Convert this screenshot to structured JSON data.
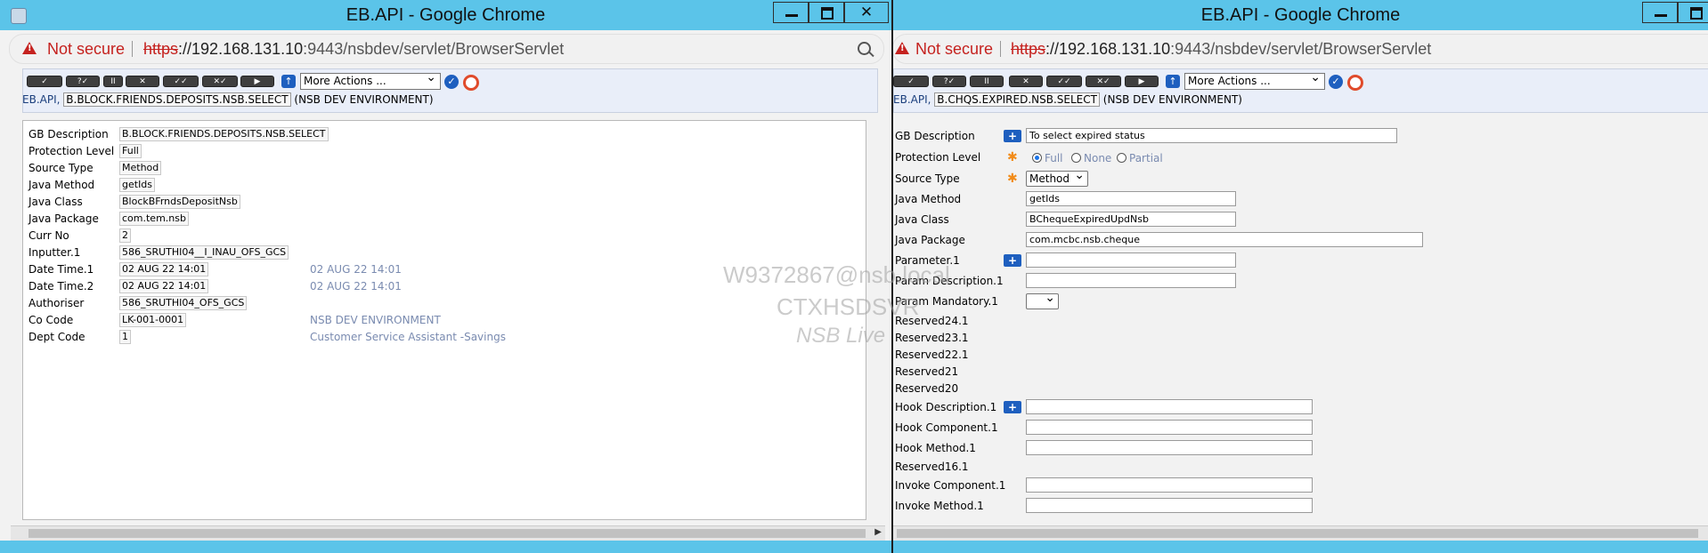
{
  "left_window": {
    "title": "EB.API - Google Chrome",
    "not_secure": "Not secure",
    "url_proto": "https",
    "url_host": "://192.168.131.10",
    "url_rest": ":9443/nsbdev/servlet/BrowserServlet",
    "toolbar_buttons": [
      "✓",
      "?✓",
      "II",
      "✕",
      "✓✓",
      "✕✓",
      "▶"
    ],
    "more_actions": "More Actions ...",
    "crumb_app": "EB.API,",
    "crumb_record": "B.BLOCK.FRIENDS.DEPOSITS.NSB.SELECT",
    "crumb_env": "(NSB DEV ENVIRONMENT)",
    "fields": [
      {
        "label": "GB Description",
        "value": "B.BLOCK.FRIENDS.DEPOSITS.NSB.SELECT",
        "enr": ""
      },
      {
        "label": "Protection Level",
        "value": "Full",
        "enr": ""
      },
      {
        "label": "Source Type",
        "value": "Method",
        "enr": ""
      },
      {
        "label": "Java Method",
        "value": "getIds",
        "enr": ""
      },
      {
        "label": "Java Class",
        "value": "BlockBFrndsDepositNsb",
        "enr": ""
      },
      {
        "label": "Java Package",
        "value": "com.tem.nsb",
        "enr": ""
      },
      {
        "label": "Curr No",
        "value": "2",
        "enr": ""
      },
      {
        "label": "Inputter.1",
        "value": "586_SRUTHI04__I_INAU_OFS_GCS",
        "enr": ""
      },
      {
        "label": "Date Time.1",
        "value": "02 AUG 22 14:01",
        "enr": "02 AUG 22 14:01"
      },
      {
        "label": "Date Time.2",
        "value": "02 AUG 22 14:01",
        "enr": "02 AUG 22 14:01"
      },
      {
        "label": "Authoriser",
        "value": "586_SRUTHI04_OFS_GCS",
        "enr": ""
      },
      {
        "label": "Co Code",
        "value": "LK-001-0001",
        "enr": "NSB DEV ENVIRONMENT"
      },
      {
        "label": "Dept Code",
        "value": "1",
        "enr": "Customer Service Assistant -Savings"
      }
    ]
  },
  "right_window": {
    "title": "EB.API - Google Chrome",
    "not_secure": "Not secure",
    "url_proto": "https",
    "url_host": "://192.168.131.10",
    "url_rest": ":9443/nsbdev/servlet/BrowserServlet",
    "more_actions": "More Actions ...",
    "crumb_app": "EB.API,",
    "crumb_record": "B.CHQS.EXPIRED.NSB.SELECT",
    "crumb_env": "(NSB DEV ENVIRONMENT)",
    "gb_description_label": "GB Description",
    "gb_description_value": "To select expired status",
    "protection_label": "Protection Level",
    "protection_options": [
      "Full",
      "None",
      "Partial"
    ],
    "source_type_label": "Source Type",
    "source_type_value": "Method",
    "java_method_label": "Java Method",
    "java_method_value": "getIds",
    "java_class_label": "Java Class",
    "java_class_value": "BChequeExpiredUpdNsb",
    "java_package_label": "Java Package",
    "java_package_value": "com.mcbc.nsb.cheque",
    "parameter_label": "Parameter.1",
    "param_desc_label": "Param Description.1",
    "param_mandatory_label": "Param Mandatory.1",
    "reserved_labels": [
      "Reserved24.1",
      "Reserved23.1",
      "Reserved22.1",
      "Reserved21",
      "Reserved20"
    ],
    "hook_description_label": "Hook Description.1",
    "hook_component_label": "Hook Component.1",
    "hook_method_label": "Hook Method.1",
    "reserved16_label": "Reserved16.1",
    "invoke_component_label": "Invoke Component.1",
    "invoke_method_label": "Invoke Method.1"
  },
  "watermark": {
    "line1": "W9372867@nsb.local",
    "line2": "CTXHSDSVR",
    "line3": "NSB Live"
  },
  "colors": {
    "titlebar": "#5bc4e9",
    "warning": "#c5221f",
    "enrichment": "#7a8bb0",
    "accent_blue": "#1e5fbf"
  }
}
